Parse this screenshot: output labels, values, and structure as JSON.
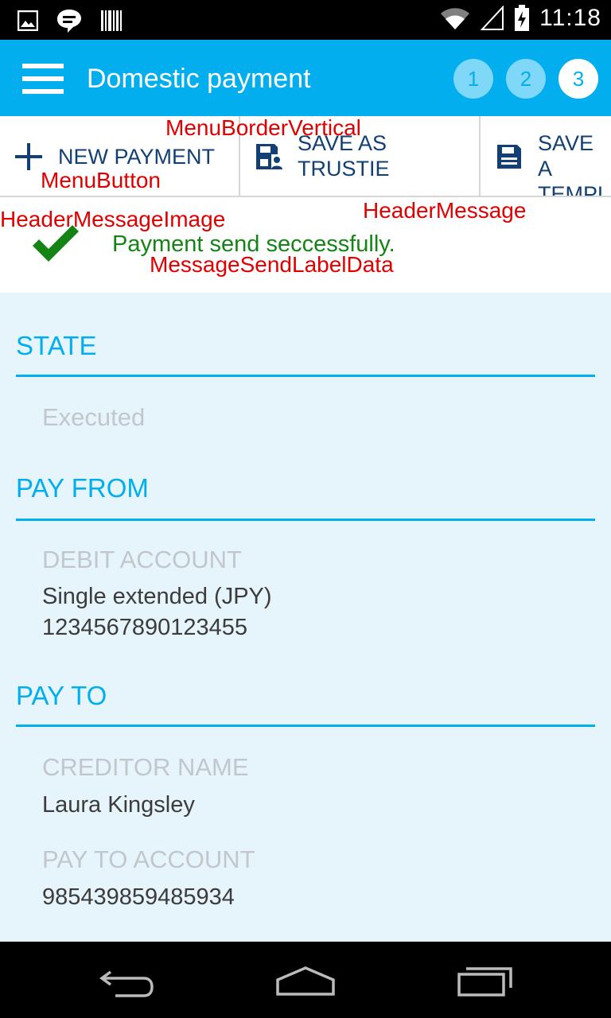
{
  "status_bar": {
    "time": "11:18",
    "icons": [
      "image-icon",
      "chat-bubble-icon",
      "barcode-icon",
      "wifi-icon",
      "signal-icon",
      "battery-charging-icon"
    ]
  },
  "app_bar": {
    "title": "Domestic payment",
    "steps": [
      "1",
      "2",
      "3"
    ],
    "active_step": "3"
  },
  "menu": {
    "new_payment_label": "NEW PAYMENT",
    "save_trustie_label_line1": "SAVE AS",
    "save_trustie_label_line2": "TRUSTIE",
    "save_template_label_line1": "SAVE A",
    "save_template_label_line2": "TEMPL"
  },
  "message": {
    "text": "Payment send seccessfully."
  },
  "annotations": {
    "menu_border_vertical": "MenuBorderVertical",
    "menu_button": "MenuButton",
    "header_message_image": "HeaderMessageImage",
    "header_message": "HeaderMessage",
    "message_send_label_data": "MessageSendLabelData"
  },
  "sections": {
    "state": {
      "title": "STATE",
      "value": "Executed"
    },
    "pay_from": {
      "title": "PAY FROM",
      "debit_account_label": "DEBIT ACCOUNT",
      "debit_account_name": "Single extended (JPY)",
      "debit_account_number": "1234567890123455"
    },
    "pay_to": {
      "title": "PAY TO",
      "creditor_name_label": "CREDITOR NAME",
      "creditor_name": "Laura Kingsley",
      "pay_to_account_label": "PAY TO ACCOUNT",
      "pay_to_account": "985439859485934"
    }
  },
  "colors": {
    "brand": "#02aeed",
    "menu_text": "#124074",
    "success": "#148414",
    "annotation": "#e00000",
    "content_bg": "#e6f4fb"
  }
}
